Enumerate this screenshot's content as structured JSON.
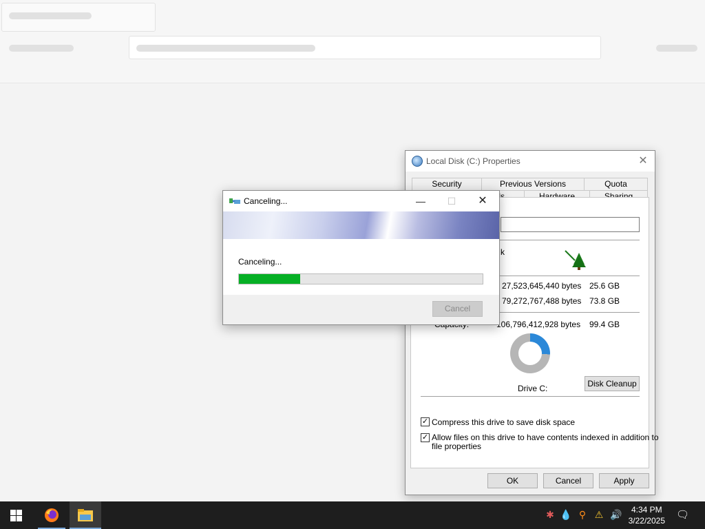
{
  "properties": {
    "title": "Local Disk (C:) Properties",
    "tabs_row1": [
      "Security",
      "Previous Versions",
      "Quota"
    ],
    "tabs_row2": [
      "ls",
      "Hardware",
      "Sharing"
    ],
    "type_fragment": "k",
    "used_bytes": "27,523,645,440 bytes",
    "used_size": "25.6 GB",
    "free_bytes": "79,272,767,488 bytes",
    "free_size": "73.8 GB",
    "capacity_label": "Capacity:",
    "capacity_bytes": "106,796,412,928 bytes",
    "capacity_size": "99.4 GB",
    "drive_label": "Drive C:",
    "disk_cleanup": "Disk Cleanup",
    "compress_label": "Compress this drive to save disk space",
    "compress_checked": true,
    "index_label_line1": "Allow files on this drive to have contents indexed in addition to",
    "index_label_line2": "file properties",
    "index_checked": true,
    "ok": "OK",
    "cancel": "Cancel",
    "apply": "Apply",
    "used_fraction": 0.258
  },
  "canceling_dialog": {
    "title": "Canceling...",
    "message": "Canceling...",
    "progress_fraction": 0.25,
    "cancel_button": "Cancel"
  },
  "taskbar": {
    "time": "4:34 PM",
    "date": "3/22/2025"
  },
  "colors": {
    "progress": "#06b025",
    "used_space": "#2b88d8",
    "free_space": "#b6b6b6"
  }
}
